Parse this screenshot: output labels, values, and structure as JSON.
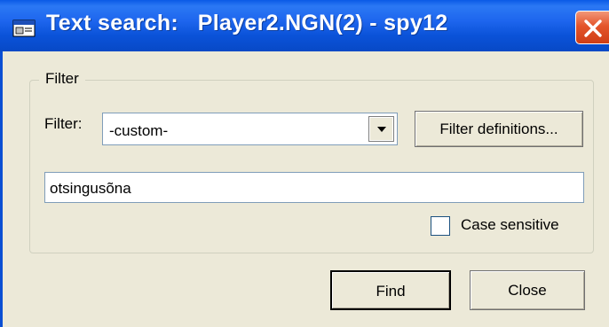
{
  "window": {
    "title": "Text search:   Player2.NGN(2) - spy12",
    "title_icon": "app-window-icon",
    "close_icon": "close-icon"
  },
  "filter_group": {
    "label": "Filter",
    "filter_label": "Filter:",
    "filter_value": "-custom-",
    "filter_definitions_button": "Filter definitions...",
    "search_text": "otsingusõna",
    "case_sensitive_label": "Case sensitive",
    "case_sensitive_checked": false
  },
  "buttons": {
    "find": "Find",
    "close": "Close"
  },
  "colors": {
    "titlebar": "#0a52d8",
    "dialog_bg": "#ece9d8",
    "close_button": "#e4552b"
  }
}
